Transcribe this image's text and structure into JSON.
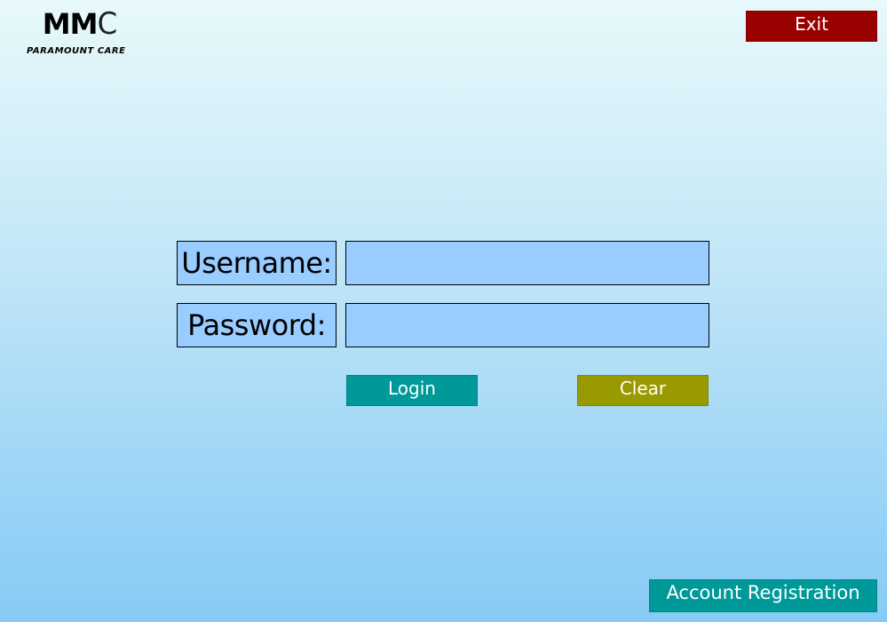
{
  "logo": {
    "mark_bold": "MM",
    "mark_light": "C",
    "subtitle": "PARAMOUNT CARE"
  },
  "header": {
    "exit_label": "Exit"
  },
  "form": {
    "username": {
      "label": "Username:",
      "value": "",
      "placeholder": ""
    },
    "password": {
      "label": "Password:",
      "value": "",
      "placeholder": ""
    },
    "login_label": "Login",
    "clear_label": "Clear"
  },
  "footer": {
    "register_label": "Account Registration"
  },
  "colors": {
    "exit": "#990000",
    "login": "#009999",
    "clear": "#999900",
    "register": "#009999",
    "field_bg": "#99ccff"
  }
}
